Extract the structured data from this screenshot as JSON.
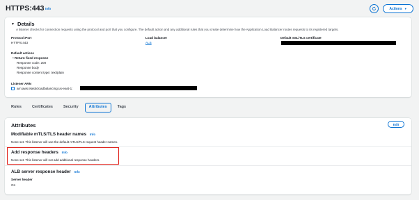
{
  "header": {
    "title": "HTTPS:443",
    "info": "Info",
    "refresh_icon": "refresh-icon",
    "actions_label": "Actions",
    "actions_icon": "caret-down-icon"
  },
  "details": {
    "heading": "Details",
    "description": "A listener checks for connection requests using the protocol and port that you configure. The default action and any additional rules that you create determine how the Application Load Balancer routes requests to its registered targets.",
    "protocol_port_label": "Protocol:Port",
    "protocol_port_value": "HTTPS:443",
    "load_balancer_label": "Load balancer",
    "load_balancer_value": "ALB",
    "ssl_label": "Default SSL/TLS certificate",
    "default_actions_label": "Default actions",
    "return_fixed_response": "Return fixed response",
    "response_code": "Response code: 200",
    "response_body": "Response body",
    "response_content_type": "Response content type: text/plain",
    "listener_arn_label": "Listener ARN",
    "listener_arn_value": "arn:aws:elasticloadbalancing:us-east-1:"
  },
  "tabs": [
    {
      "label": "Rules",
      "active": false
    },
    {
      "label": "Certificates",
      "active": false
    },
    {
      "label": "Security",
      "active": false
    },
    {
      "label": "Attributes",
      "active": true
    },
    {
      "label": "Tags",
      "active": false
    }
  ],
  "attributes": {
    "title": "Attributes",
    "edit_label": "Edit",
    "mtls_title": "Modifiable mTLS/TLS header names",
    "mtls_info": "Info",
    "mtls_body": "None set. This listener will use the default mTLS/TLS request header names.",
    "add_headers_title": "Add response headers",
    "add_headers_info": "Info",
    "add_headers_body": "None set. This listener will not add additional response headers.",
    "alb_server_title": "ALB server response header",
    "alb_server_info": "Info",
    "server_header_label": "Server header",
    "server_header_value": "On"
  },
  "colors": {
    "accent": "#0972d3",
    "highlight": "#e0221b",
    "background": "#f2f3f3"
  }
}
